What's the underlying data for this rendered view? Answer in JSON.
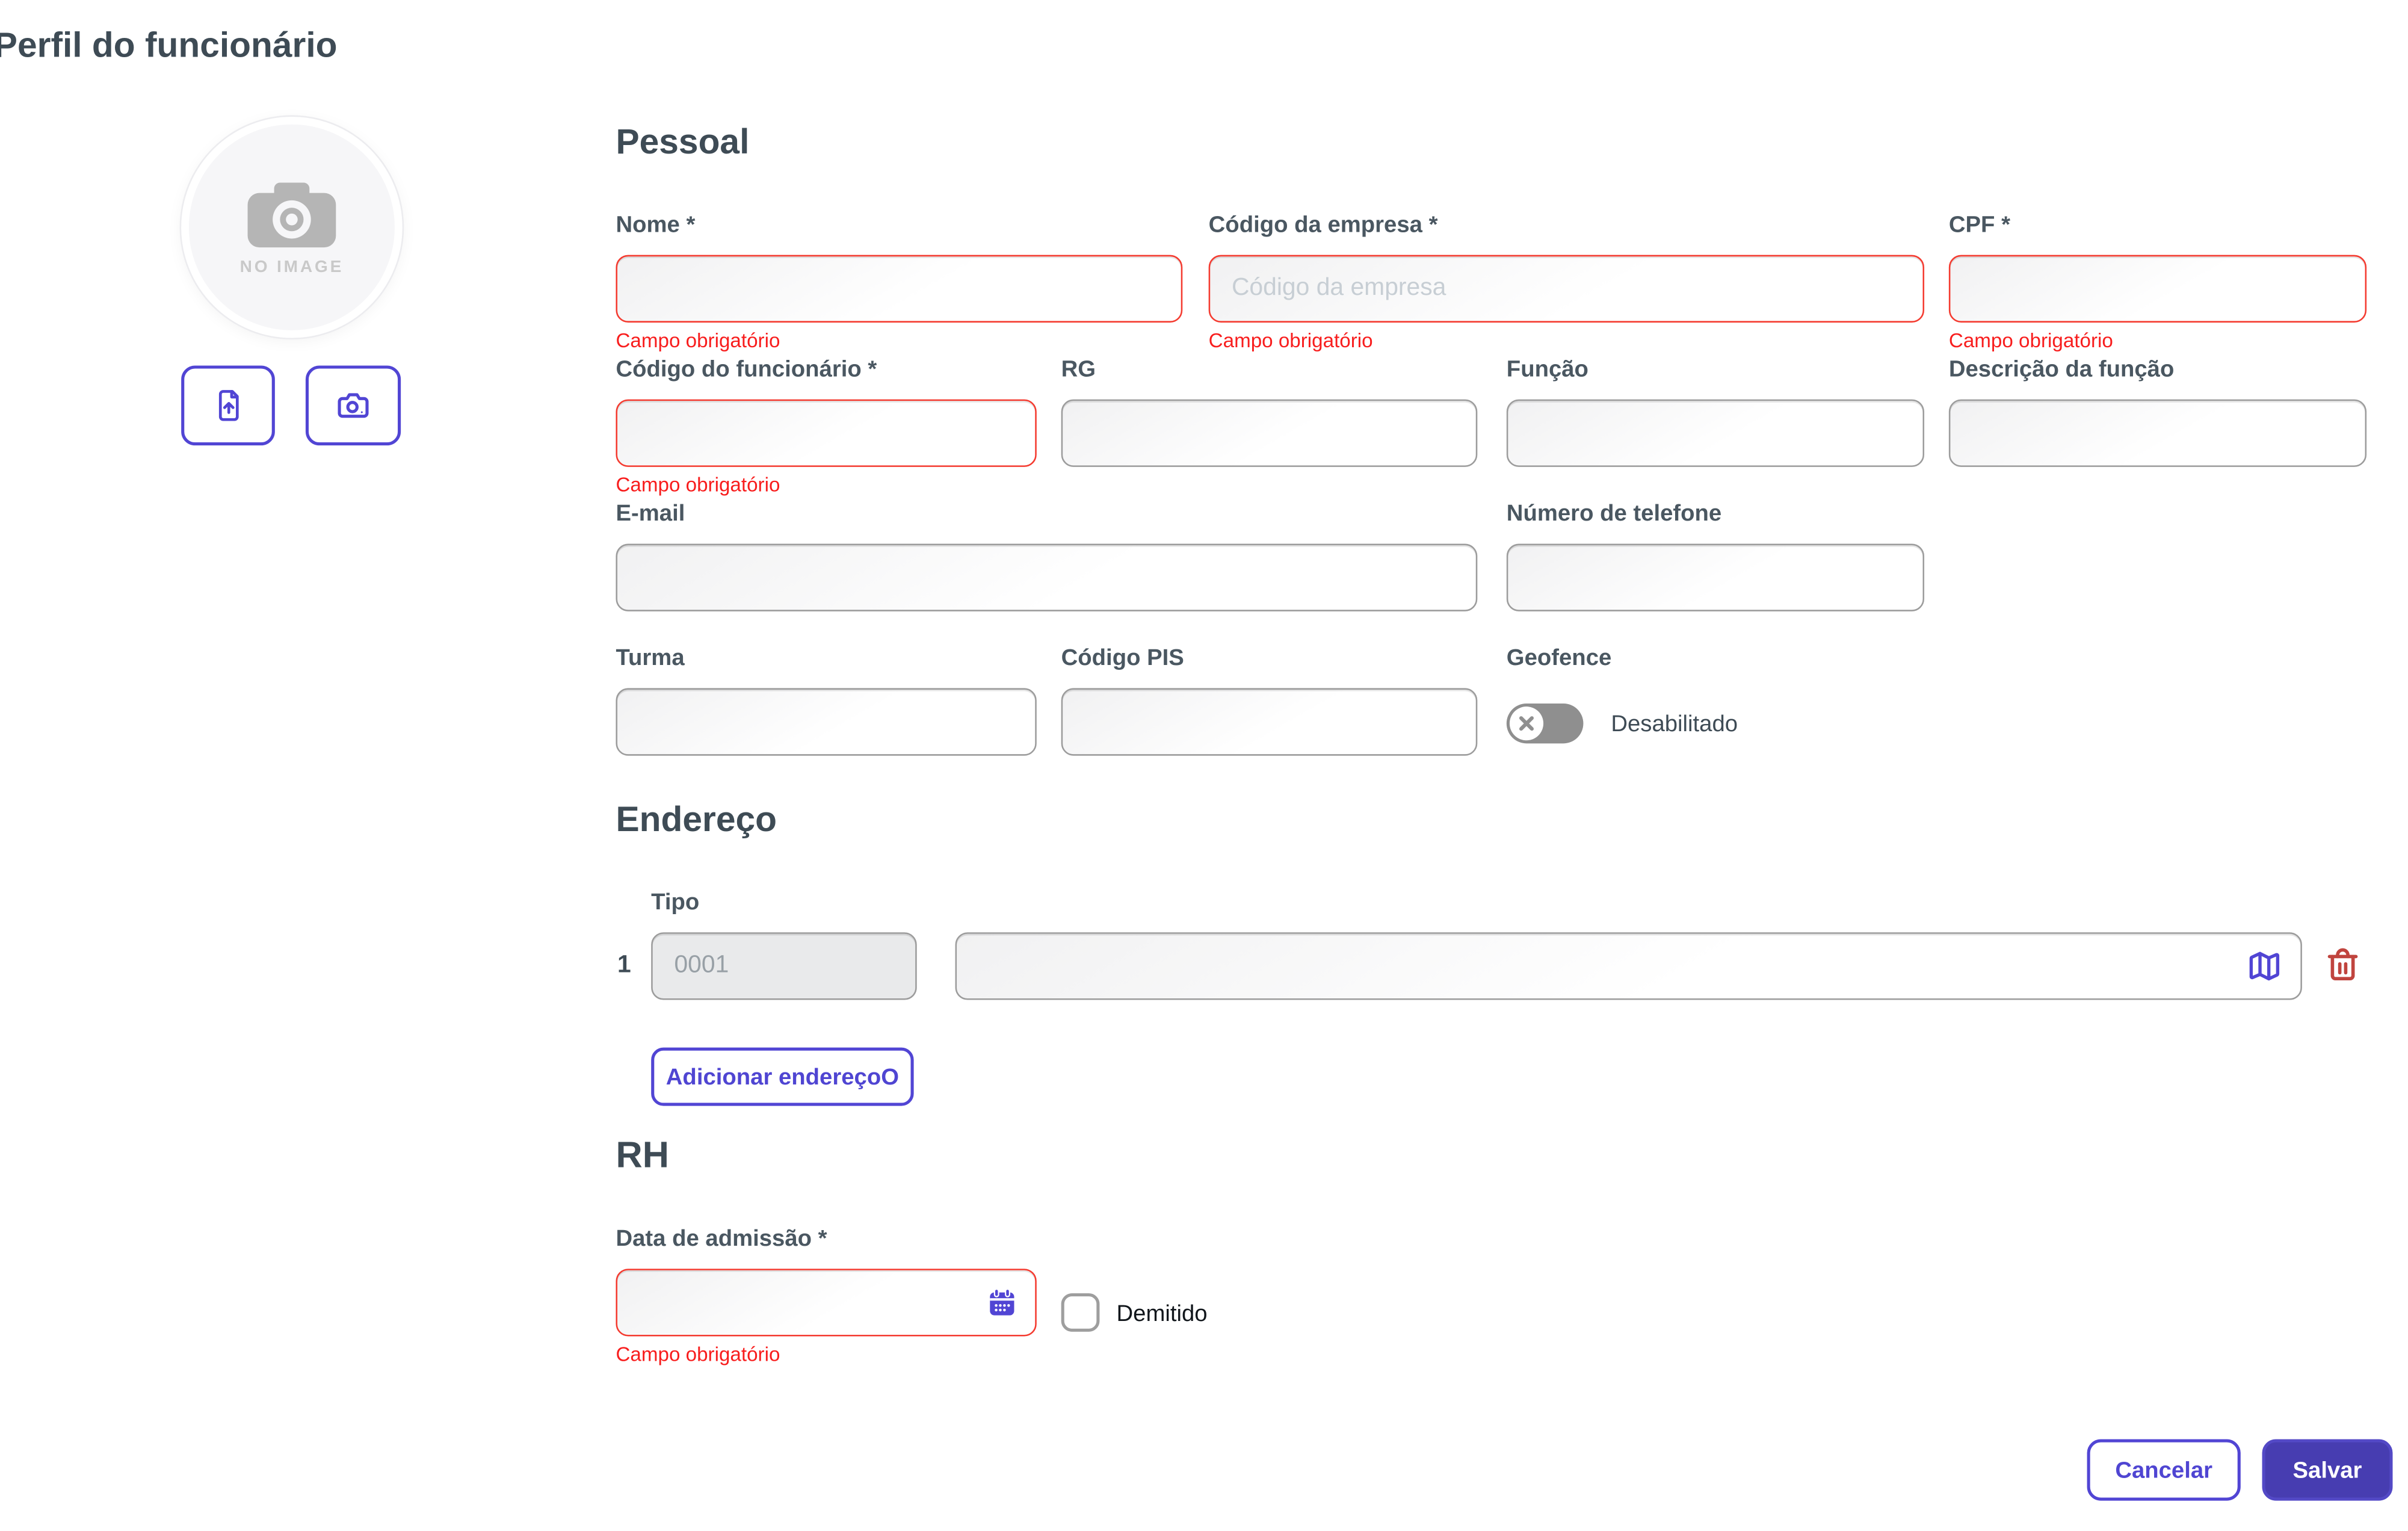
{
  "title": "Perfil do funcionário",
  "photo": {
    "no_image": "NO IMAGE"
  },
  "pessoal": {
    "title": "Pessoal",
    "nome": {
      "label": "Nome *",
      "value": "",
      "error": "Campo obrigatório"
    },
    "codigo_empresa": {
      "label": "Código da empresa *",
      "value": "",
      "placeholder": "Código da empresa",
      "error": "Campo obrigatório"
    },
    "cpf": {
      "label": "CPF *",
      "value": "",
      "error": "Campo obrigatório"
    },
    "codigo_funcionario": {
      "label": "Código do funcionário *",
      "value": "",
      "error": "Campo obrigatório"
    },
    "rg": {
      "label": "RG",
      "value": ""
    },
    "funcao": {
      "label": "Função",
      "value": ""
    },
    "descricao_funcao": {
      "label": "Descrição da função",
      "value": ""
    },
    "email": {
      "label": "E-mail",
      "value": ""
    },
    "telefone": {
      "label": "Número de telefone",
      "value": ""
    },
    "turma": {
      "label": "Turma",
      "value": ""
    },
    "codigo_pis": {
      "label": "Código PIS",
      "value": ""
    },
    "geofence": {
      "label": "Geofence",
      "state": "Desabilitado",
      "enabled": false
    }
  },
  "endereco": {
    "title": "Endereço",
    "tipo_label": "Tipo",
    "rows": [
      {
        "index": "1",
        "tipo_value": "0001",
        "address_value": ""
      }
    ],
    "add_button": "Adicionar endereçoO"
  },
  "rh": {
    "title": "RH",
    "data_admissao": {
      "label": "Data de admissão *",
      "value": "",
      "error": "Campo obrigatório"
    },
    "demitido": {
      "label": "Demitido",
      "checked": false
    }
  },
  "footer": {
    "cancel": "Cancelar",
    "save": "Salvar"
  },
  "colors": {
    "primary": "#5145d4",
    "save_background": "#473db1",
    "error_red": "#f81d1d",
    "field_border_gray": "#9c9c9c",
    "toggle_gray": "#8f8f8f",
    "trash_red": "#c0443e",
    "heading_slate": "#3e4b55"
  }
}
